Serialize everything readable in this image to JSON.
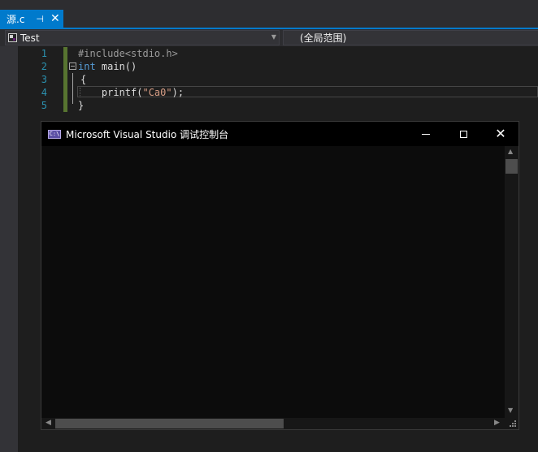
{
  "tab": {
    "label": "源.c",
    "pin": "⊣",
    "close": "✕"
  },
  "navbar": {
    "project": "Test",
    "scope": "(全局范围)"
  },
  "editor": {
    "line_numbers": [
      "1",
      "2",
      "3",
      "4",
      "5"
    ],
    "lines": {
      "l1_pp": "#include<stdio.h>",
      "l2_kw": "int",
      "l2_rest": " main()",
      "l3": "{",
      "l4_fn": "    printf(",
      "l4_str": "\"Ca0\"",
      "l4_end": ");",
      "l5": "}"
    }
  },
  "console": {
    "title": "Microsoft Visual Studio 调试控制台",
    "icon_text": "C:\\"
  }
}
